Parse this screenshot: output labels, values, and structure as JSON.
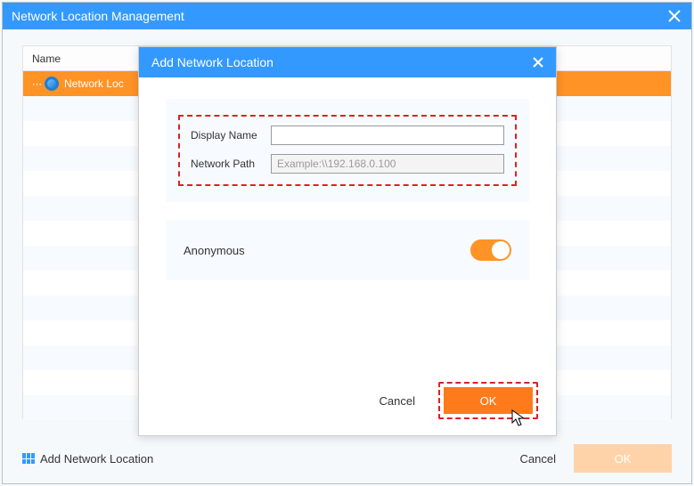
{
  "main": {
    "title": "Network Location Management",
    "table": {
      "header": "Name",
      "rows": [
        {
          "label": "Network Loc",
          "selected": true
        },
        {
          "label": ""
        },
        {
          "label": ""
        },
        {
          "label": ""
        },
        {
          "label": ""
        },
        {
          "label": ""
        },
        {
          "label": ""
        },
        {
          "label": ""
        },
        {
          "label": ""
        },
        {
          "label": ""
        },
        {
          "label": ""
        },
        {
          "label": ""
        },
        {
          "label": ""
        },
        {
          "label": ""
        }
      ]
    },
    "add_link": "Add Network Location",
    "cancel": "Cancel",
    "ok": "OK"
  },
  "modal": {
    "title": "Add Network Location",
    "display_name_label": "Display Name",
    "display_name_value": "",
    "network_path_label": "Network Path",
    "network_path_placeholder": "Example:\\\\192.168.0.100",
    "network_path_value": "",
    "anonymous_label": "Anonymous",
    "anonymous_on": true,
    "cancel": "Cancel",
    "ok": "OK"
  },
  "colors": {
    "primary": "#3399ff",
    "accent": "#ff9326",
    "highlight_border": "#dd2222"
  }
}
